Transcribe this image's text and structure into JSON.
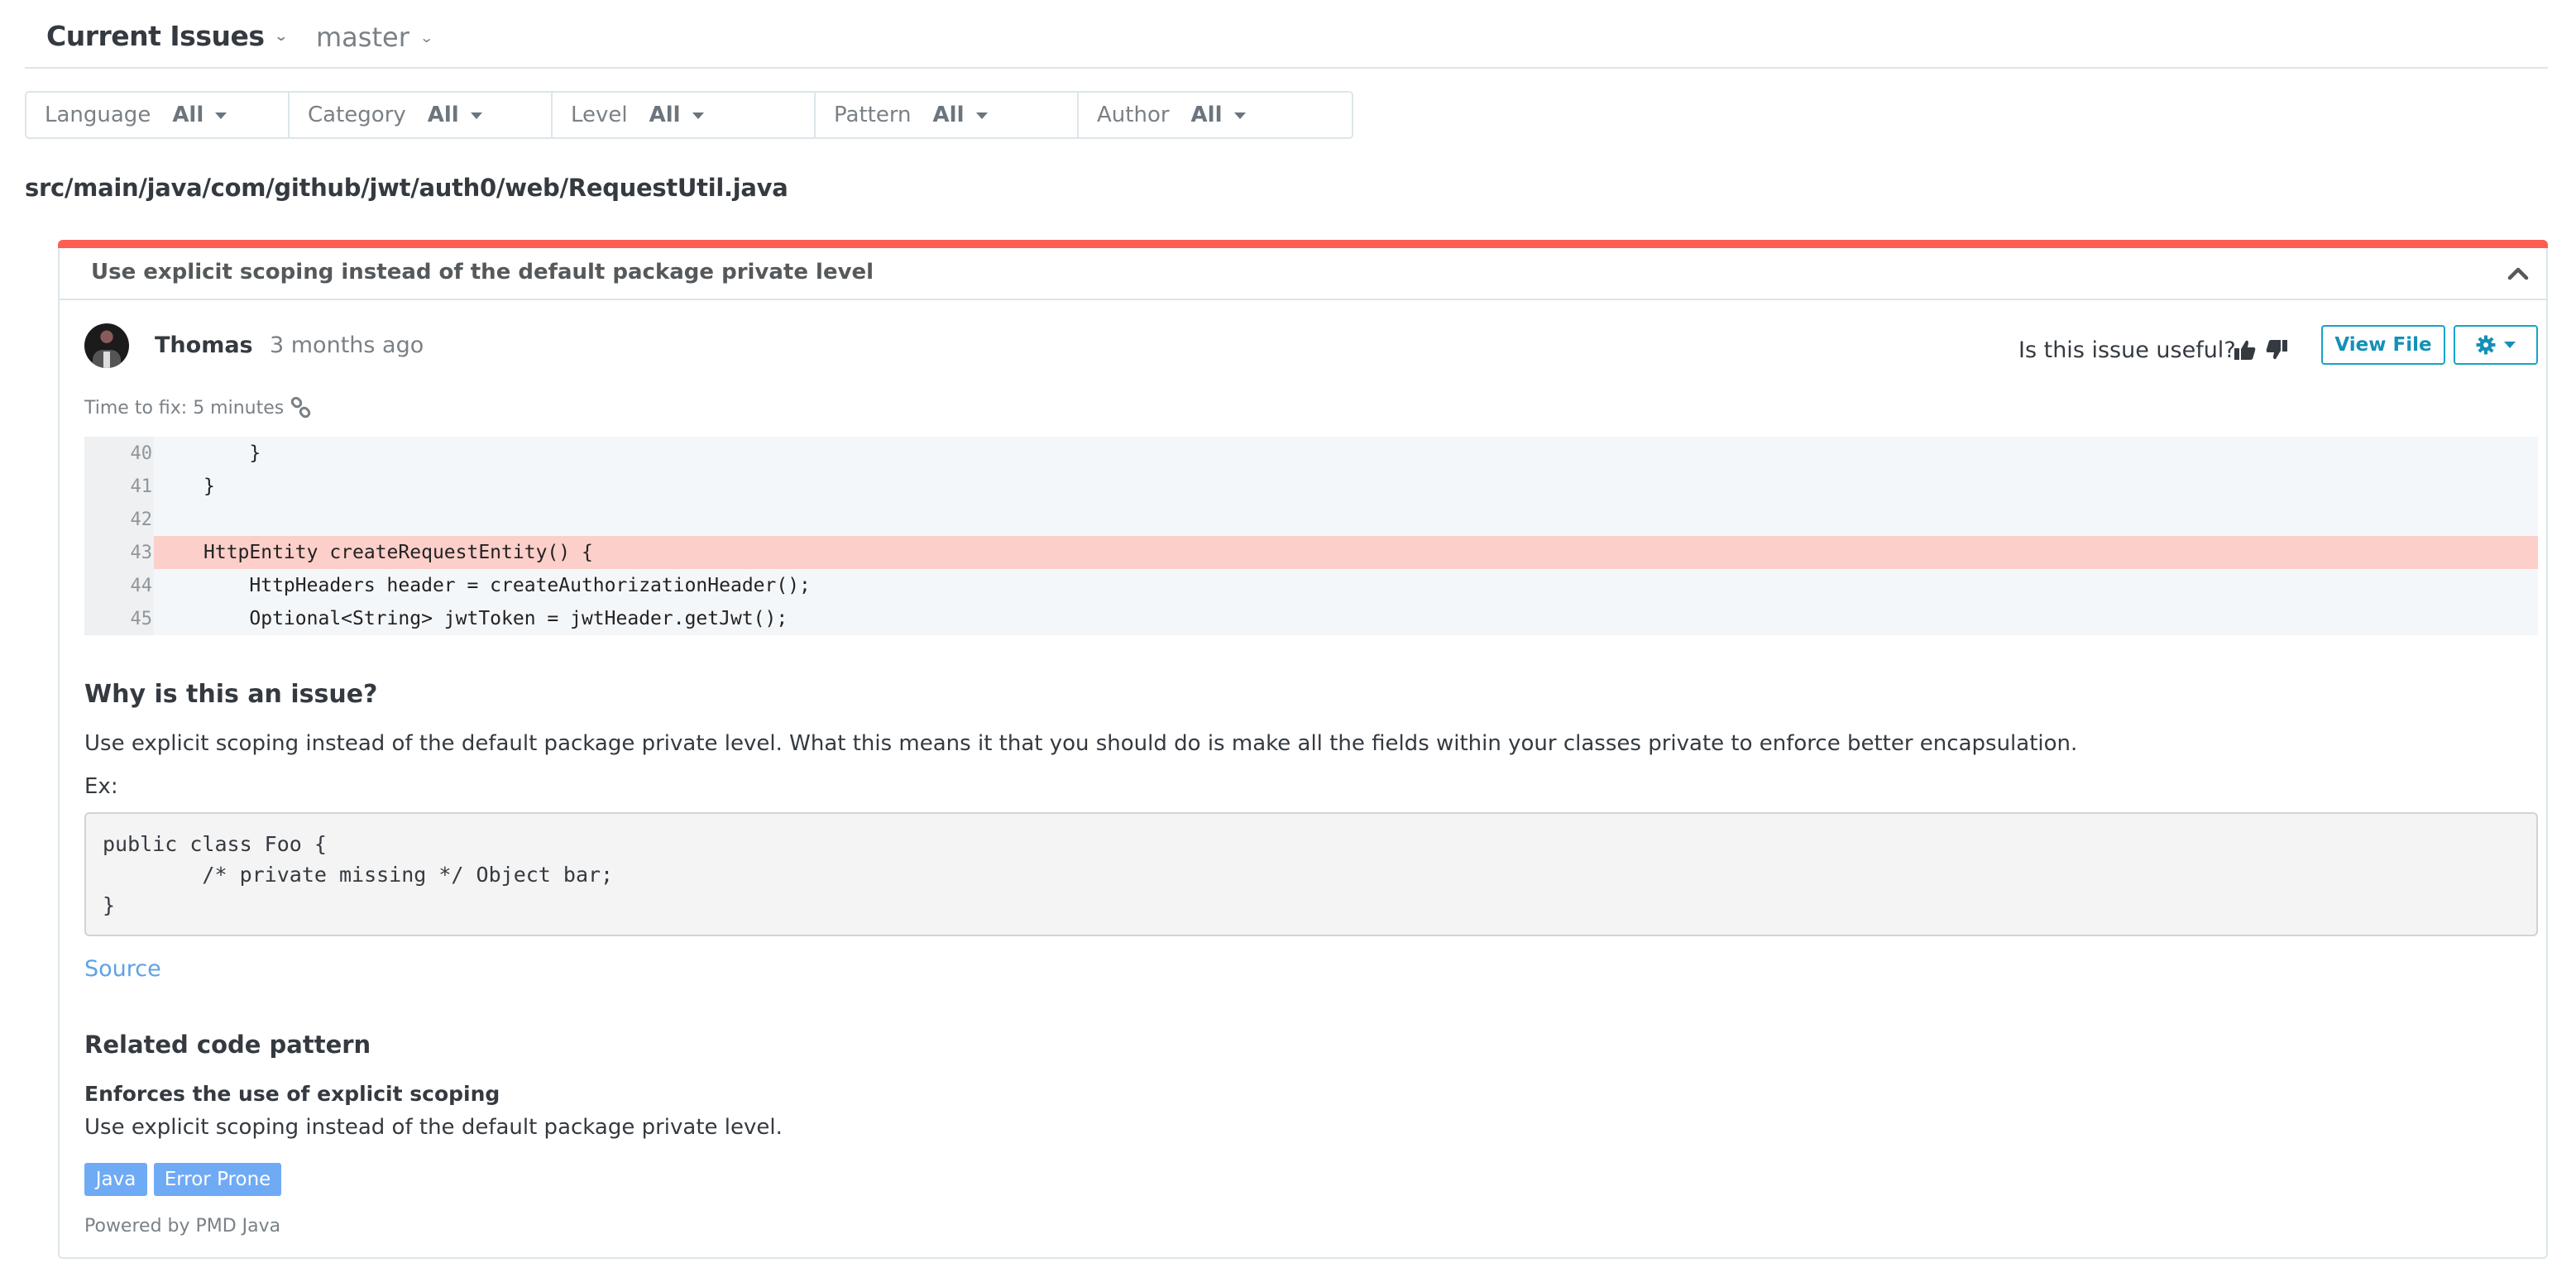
{
  "header": {
    "title": "Current Issues",
    "branch": "master"
  },
  "filters": [
    {
      "label": "Language",
      "value": "All"
    },
    {
      "label": "Category",
      "value": "All"
    },
    {
      "label": "Level",
      "value": "All"
    },
    {
      "label": "Pattern",
      "value": "All"
    },
    {
      "label": "Author",
      "value": "All"
    }
  ],
  "file_path": "src/main/java/com/github/jwt/auth0/web/RequestUtil.java",
  "issue": {
    "title": "Use explicit scoping instead of the default package private level",
    "severity_color": "#fd5e53",
    "author": {
      "name": "Thomas",
      "time": "3 months ago",
      "avatar": "avatar-photo"
    },
    "useful_prompt": "Is this issue useful?",
    "view_file_label": "View File",
    "time_to_fix": "Time to fix: 5 minutes",
    "code_lines": [
      {
        "number": "40",
        "text": "    }",
        "highlight": false
      },
      {
        "number": "41",
        "text": "}",
        "highlight": false
      },
      {
        "number": "42",
        "text": "",
        "highlight": false
      },
      {
        "number": "43",
        "text": "HttpEntity createRequestEntity() {",
        "highlight": true
      },
      {
        "number": "44",
        "text": "    HttpHeaders header = createAuthorizationHeader();",
        "highlight": false
      },
      {
        "number": "45",
        "text": "    Optional<String> jwtToken = jwtHeader.getJwt();",
        "highlight": false
      }
    ],
    "why": {
      "title": "Why is this an issue?",
      "text": "Use explicit scoping instead of the default package private level. What this means it that you should do is make all the fields within your classes private to enforce better encapsulation.",
      "example_label": "Ex:",
      "example_code": "public class Foo {\n        /* private missing */ Object bar;\n}",
      "source_label": "Source"
    },
    "related": {
      "title": "Related code pattern",
      "pattern_name": "Enforces the use of explicit scoping",
      "pattern_description": "Use explicit scoping instead of the default package private level.",
      "tags": [
        "Java",
        "Error Prone"
      ],
      "powered_by": "Powered by PMD Java"
    }
  }
}
